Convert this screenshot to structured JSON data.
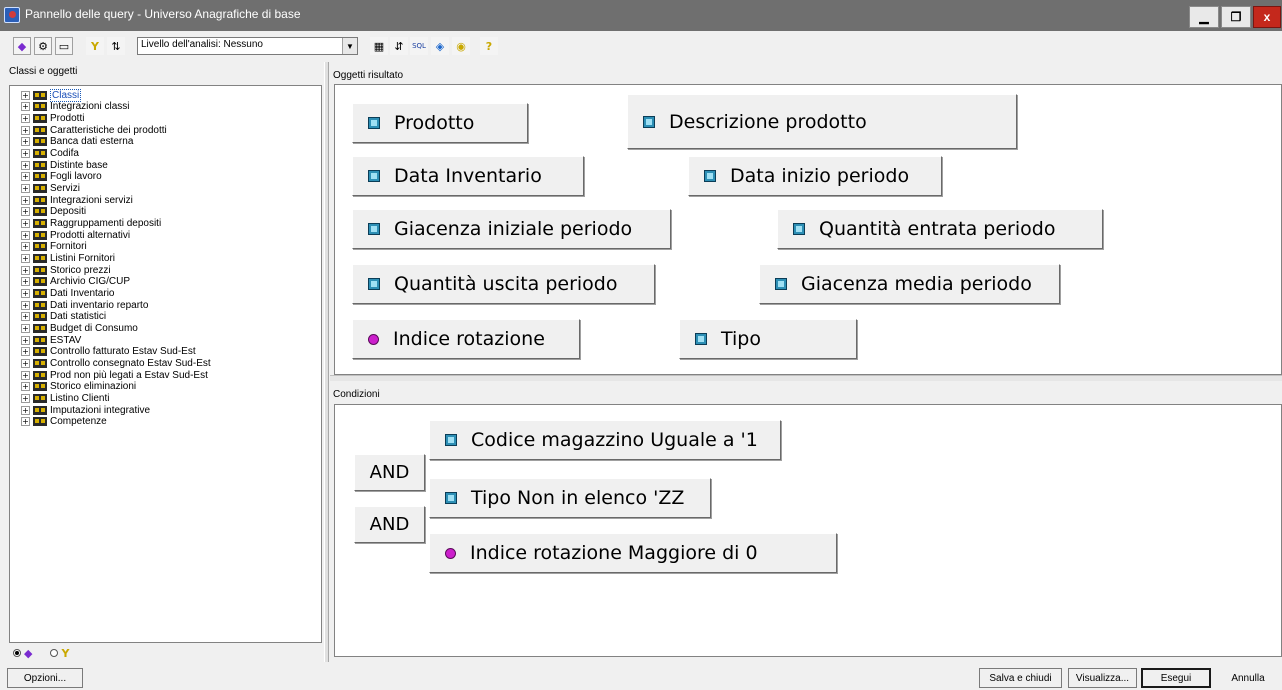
{
  "window": {
    "title": "Pannello delle query - Universo Anagrafiche di base",
    "min_glyph": "▁",
    "max_glyph": "❐",
    "close_glyph": "x"
  },
  "toolbar": {
    "level_select": "Livello dell'analisi: Nessuno",
    "buttons": [
      {
        "name": "classes-view-icon",
        "glyph": "◆"
      },
      {
        "name": "objects-view-icon",
        "glyph": "⚙"
      },
      {
        "name": "window-icon",
        "glyph": "▭"
      },
      {
        "name": "filter-icon",
        "glyph": "Y"
      },
      {
        "name": "sort-icon",
        "glyph": "⇅"
      },
      {
        "name": "scope-icon",
        "glyph": "▦"
      },
      {
        "name": "sort-az-icon",
        "glyph": "⇵"
      },
      {
        "name": "sql-icon",
        "glyph": "SQL"
      },
      {
        "name": "combine-icon",
        "glyph": "◈"
      },
      {
        "name": "options-icon",
        "glyph": "◉"
      },
      {
        "name": "help-icon",
        "glyph": "?"
      }
    ]
  },
  "left": {
    "label": "Classi e oggetti",
    "tree": [
      "Classi",
      "Integrazioni classi",
      "Prodotti",
      "Caratteristiche dei prodotti",
      "Banca dati esterna",
      "Codifa",
      "Distinte base",
      "Fogli lavoro",
      "Servizi",
      "Integrazioni servizi",
      "Depositi",
      "Raggruppamenti depositi",
      "Prodotti alternativi",
      "Fornitori",
      "Listini Fornitori",
      "Storico prezzi",
      "Archivio CIG/CUP",
      "Dati Inventario",
      "Dati inventario reparto",
      "Dati statistici",
      "Budget di Consumo",
      "ESTAV",
      "Controllo fatturato Estav Sud-Est",
      "Controllo consegnato Estav Sud-Est",
      "Prod non più legati a Estav Sud-Est",
      "Storico eliminazioni",
      "Listino Clienti",
      "Imputazioni integrative",
      "Competenze"
    ],
    "expander_glyph": "+"
  },
  "results": {
    "label": "Oggetti risultato",
    "objects": [
      {
        "label": "Prodotto",
        "kind": "dimension"
      },
      {
        "label": "Descrizione prodotto",
        "kind": "dimension"
      },
      {
        "label": "Data Inventario",
        "kind": "dimension"
      },
      {
        "label": "Data inizio periodo",
        "kind": "dimension"
      },
      {
        "label": "Giacenza iniziale periodo",
        "kind": "dimension"
      },
      {
        "label": "Quantità entrata periodo",
        "kind": "dimension"
      },
      {
        "label": "Quantità uscita periodo",
        "kind": "dimension"
      },
      {
        "label": "Giacenza media periodo",
        "kind": "dimension"
      },
      {
        "label": "Indice rotazione",
        "kind": "measure"
      },
      {
        "label": "Tipo",
        "kind": "dimension"
      }
    ]
  },
  "conditions": {
    "label": "Condizioni",
    "and_label": "AND",
    "items": [
      {
        "label": "Codice magazzino Uguale a '1",
        "kind": "dimension"
      },
      {
        "label": "Tipo Non in elenco 'ZZ",
        "kind": "dimension"
      },
      {
        "label": "Indice rotazione Maggiore di 0",
        "kind": "measure"
      }
    ]
  },
  "radios": {
    "objects_glyph": "◆",
    "filters_glyph": "Y"
  },
  "footer": {
    "options": "Opzioni...",
    "save_close": "Salva e chiudi",
    "view": "Visualizza...",
    "run": "Esegui",
    "cancel": "Annulla"
  },
  "colors": {
    "titlebar": "#6f6f6f",
    "close": "#c4281c",
    "dimension": "#2d8fb5",
    "measure": "#cc1fcc"
  }
}
